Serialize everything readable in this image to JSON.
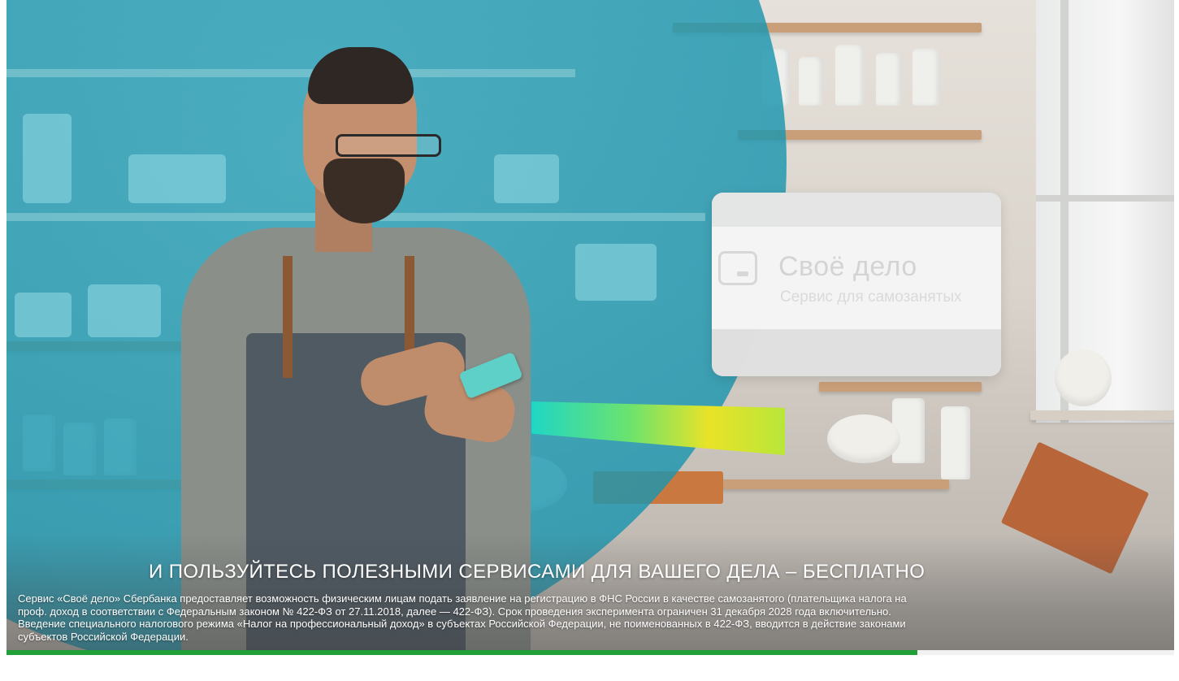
{
  "card": {
    "title": "Своё дело",
    "subtitle": "Сервис для самозанятых"
  },
  "caption": {
    "headline": "И ПОЛЬЗУЙТЕСЬ ПОЛЕЗНЫМИ СЕРВИСАМИ ДЛЯ ВАШЕГО ДЕЛА – БЕСПЛАТНО",
    "disclaimer_lines": [
      "Сервис «Своё дело» Сбербанка предоставляет возможность физическим лицам подать заявление на регистрацию в ФНС России в качестве самозанятого (плательщика налога на",
      "проф. доход в соответствии с Федеральным законом № 422-ФЗ от 27.11.2018, далее — 422-ФЗ). Срок проведения эксперимента ограничен 31 декабря 2028 года включительно.",
      "Введение специального налогового режима «Налог на профессиональный доход» в субъектах Российской Федерации, не поименованных в 422-ФЗ, вводится в действие законами",
      "субъектов Российской Федерации."
    ]
  },
  "video": {
    "progress": 0.78,
    "progress_color": "#21a038"
  },
  "colors": {
    "brand_green": "#21a038",
    "teal_overlay": "#1f9fb7"
  }
}
